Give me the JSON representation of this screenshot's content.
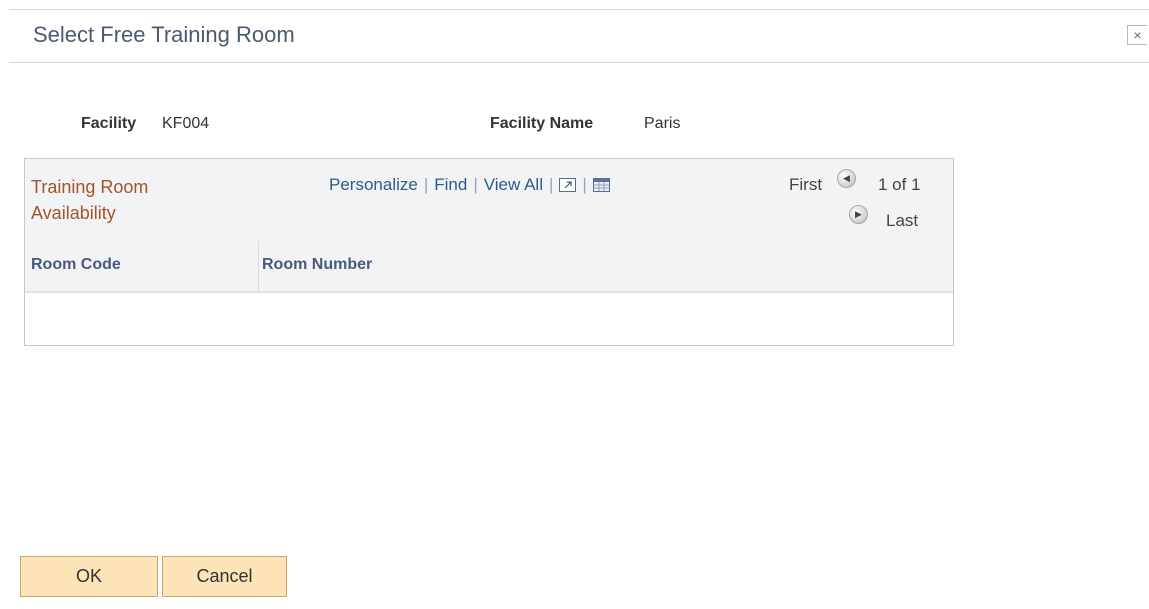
{
  "dialog": {
    "title": "Select Free Training Room",
    "close_glyph": "×"
  },
  "fields": {
    "facility_label": "Facility",
    "facility_value": "KF004",
    "facility_name_label": "Facility Name",
    "facility_name_value": "Paris"
  },
  "grid": {
    "title_line1": "Training Room",
    "title_line2": "Availability",
    "nav": {
      "personalize": "Personalize",
      "find": "Find",
      "view_all": "View All",
      "separator": "|"
    },
    "pager": {
      "first": "First",
      "count": "1 of 1",
      "last": "Last"
    },
    "columns": [
      "Room Code",
      "Room Number"
    ],
    "rows": [
      [
        "",
        ""
      ]
    ]
  },
  "buttons": {
    "ok": "OK",
    "cancel": "Cancel"
  },
  "colors": {
    "title": "#4a5a70",
    "grid_title": "#a5532a",
    "link": "#2e5a8c",
    "button_bg": "#fde3b8"
  },
  "icons": {
    "close": "close-icon",
    "new_window": "new-window-icon",
    "spreadsheet": "spreadsheet-icon",
    "prev": "previous-arrow-icon",
    "next": "next-arrow-icon"
  }
}
